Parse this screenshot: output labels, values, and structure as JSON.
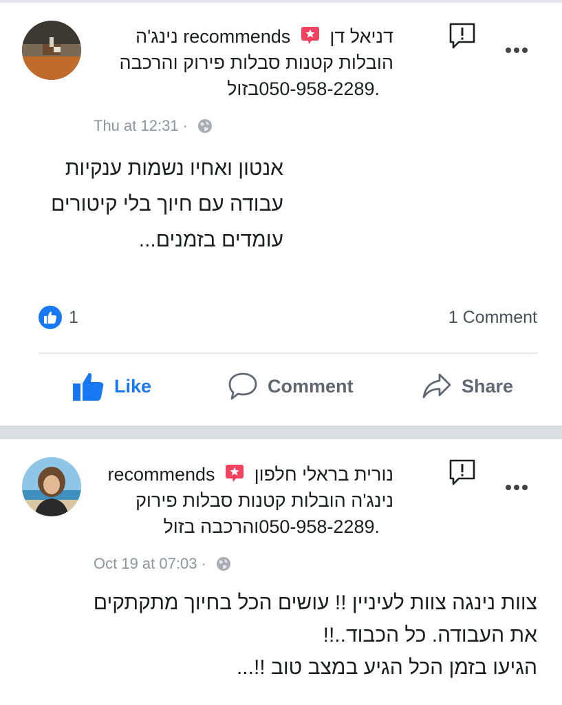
{
  "post1": {
    "author": "דניאל דן",
    "recommends": "recommends",
    "business_name": "נינג'ה",
    "business_line2": "הובלות קטנות סבלות פירוק והרכבה",
    "business_line3": ".050-958-2289בזול",
    "timestamp": "Thu at 12:31",
    "body": [
      "אנטון ואחיו נשמות ענקיות",
      "עבודה עם חיוך בלי קיטורים",
      "עומדים בזמנים..."
    ],
    "like_count": "1",
    "comment_count": "1 Comment",
    "actions": {
      "like": "Like",
      "comment": "Comment",
      "share": "Share"
    }
  },
  "post2": {
    "author": "נורית בראלי חלפון",
    "recommends": "recommends",
    "business_line2": "נינג'ה הובלות קטנות סבלות פירוק",
    "business_line3": ".050-958-2289והרכבה בזול",
    "timestamp": "Oct 19 at 07:03",
    "body": [
      "צוות נינגה צוות לעיניין !! עושים הכל בחיוך מתקתקים",
      "את העבודה. כל הכבוד..!!",
      "הגיעו בזמן הכל הגיע במצב טוב !!..."
    ]
  },
  "colors": {
    "accent": "#1877f2",
    "badge": "#f3425f",
    "meta": "#90949c",
    "separator": "#dadde1"
  },
  "icons": [
    "recommendation-badge-icon",
    "report-icon",
    "more-options-icon",
    "globe-icon",
    "like-reaction-icon",
    "thumbs-up-icon",
    "comment-icon",
    "share-icon"
  ]
}
